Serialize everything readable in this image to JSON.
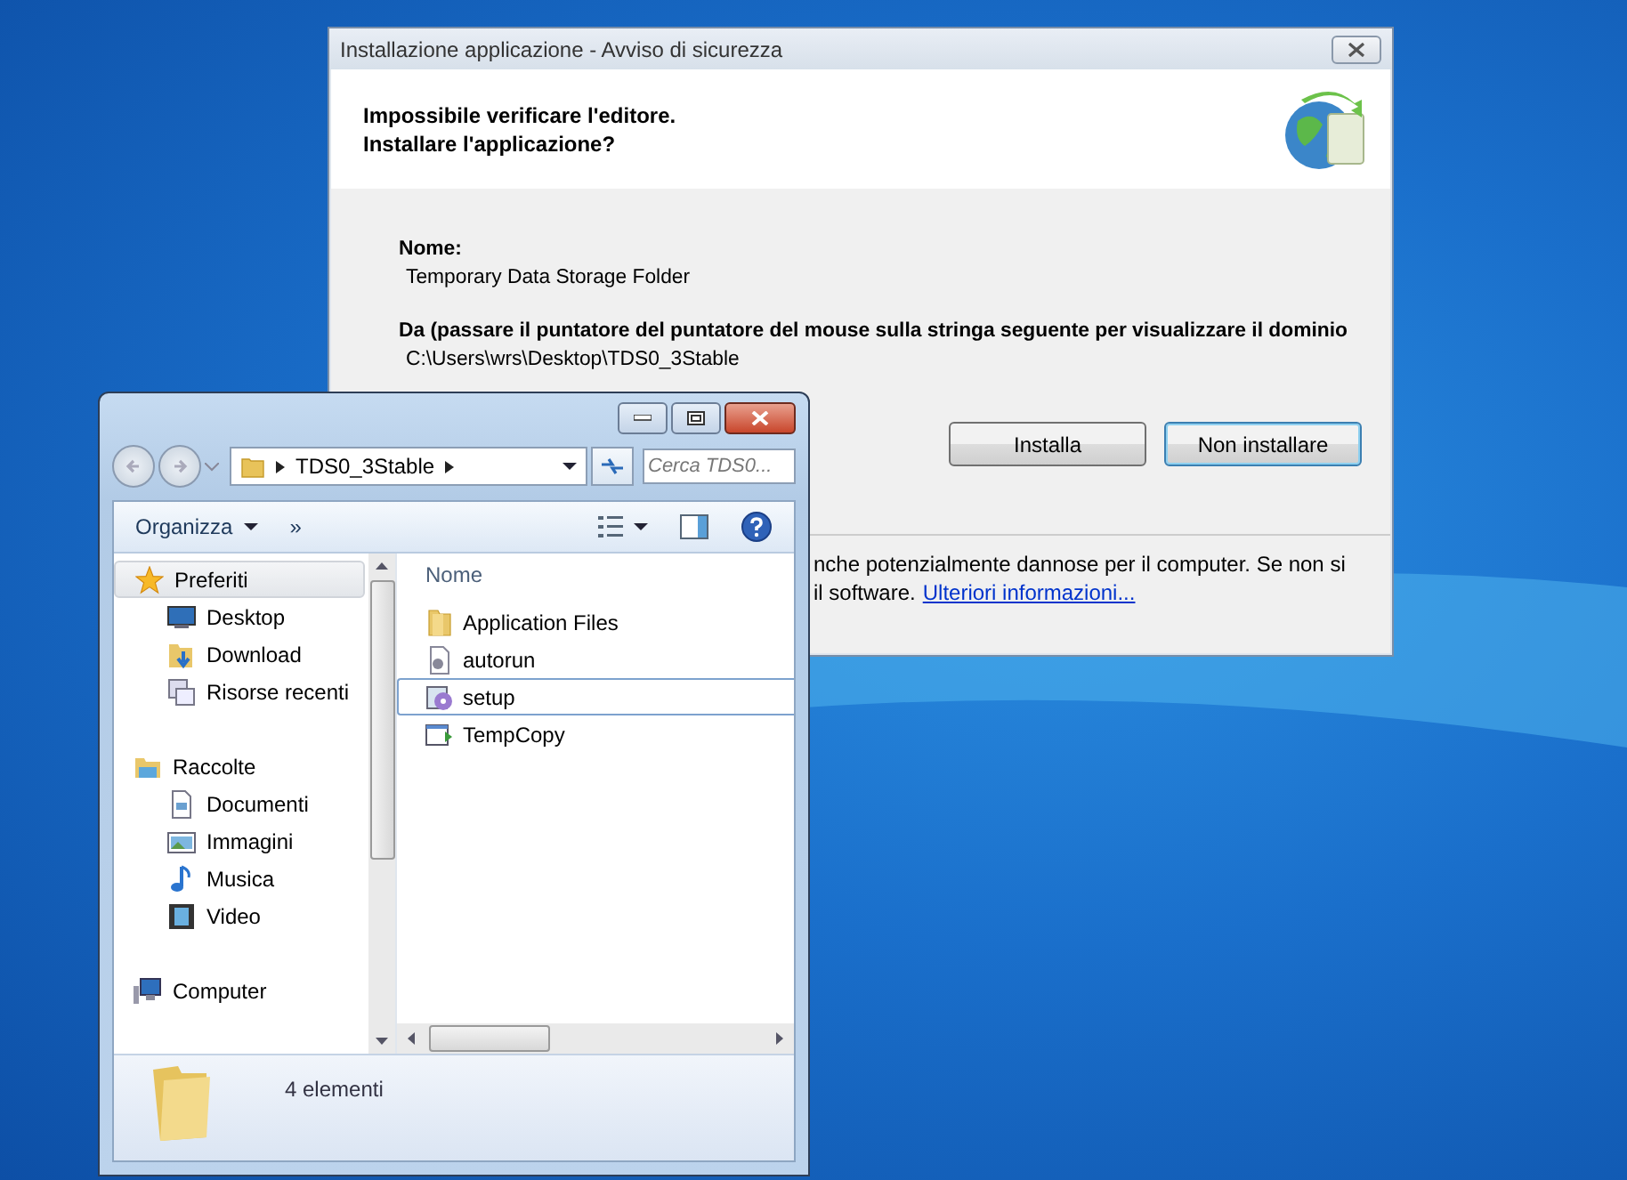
{
  "dialog": {
    "title": "Installazione applicazione - Avviso di sicurezza",
    "heading_lines": [
      "Impossibile verificare l'editore.",
      "Installare l'applicazione?"
    ],
    "fields": [
      {
        "label": "Nome:",
        "value": "Temporary Data Storage Folder"
      },
      {
        "label": "Da (passare il puntatore del puntatore del mouse sulla stringa seguente per visualizzare il dominio",
        "value": "C:\\Users\\wrs\\Desktop\\TDS0_3Stable"
      }
    ],
    "buttons": [
      {
        "label": "Installa",
        "focused": false
      },
      {
        "label": "Non installare",
        "focused": true
      }
    ],
    "footer": {
      "lines": [
        "nche potenzialmente dannose per il computer. Se non si",
        "il software."
      ],
      "link": "Ulteriori informazioni..."
    }
  },
  "explorer": {
    "address": {
      "crumbs": [
        "TDS0_3Stable"
      ]
    },
    "search": {
      "placeholder": "Cerca TDS0..."
    },
    "toolbar": {
      "organize": "Organizza",
      "more": "»"
    },
    "nav": [
      {
        "label": "Preferiti",
        "kind": "star",
        "selected": true,
        "children": [
          {
            "label": "Desktop",
            "kind": "desktop",
            "selected": false
          },
          {
            "label": "Download",
            "kind": "download",
            "selected": false
          },
          {
            "label": "Risorse recenti",
            "kind": "recent",
            "selected": false
          }
        ]
      },
      {
        "label": "Raccolte",
        "kind": "library",
        "selected": false,
        "children": [
          {
            "label": "Documenti",
            "kind": "document",
            "selected": false
          },
          {
            "label": "Immagini",
            "kind": "picture",
            "selected": false
          },
          {
            "label": "Musica",
            "kind": "music",
            "selected": false
          },
          {
            "label": "Video",
            "kind": "video",
            "selected": false
          }
        ]
      },
      {
        "label": "Computer",
        "kind": "computer",
        "selected": false
      }
    ],
    "column_header": "Nome",
    "files": [
      {
        "name": "Application Files",
        "kind": "folder",
        "selected": false
      },
      {
        "name": "autorun",
        "kind": "config",
        "selected": false
      },
      {
        "name": "setup",
        "kind": "app",
        "selected": true
      },
      {
        "name": "TempCopy",
        "kind": "shortcut",
        "selected": false
      }
    ],
    "status": "4 elementi"
  }
}
